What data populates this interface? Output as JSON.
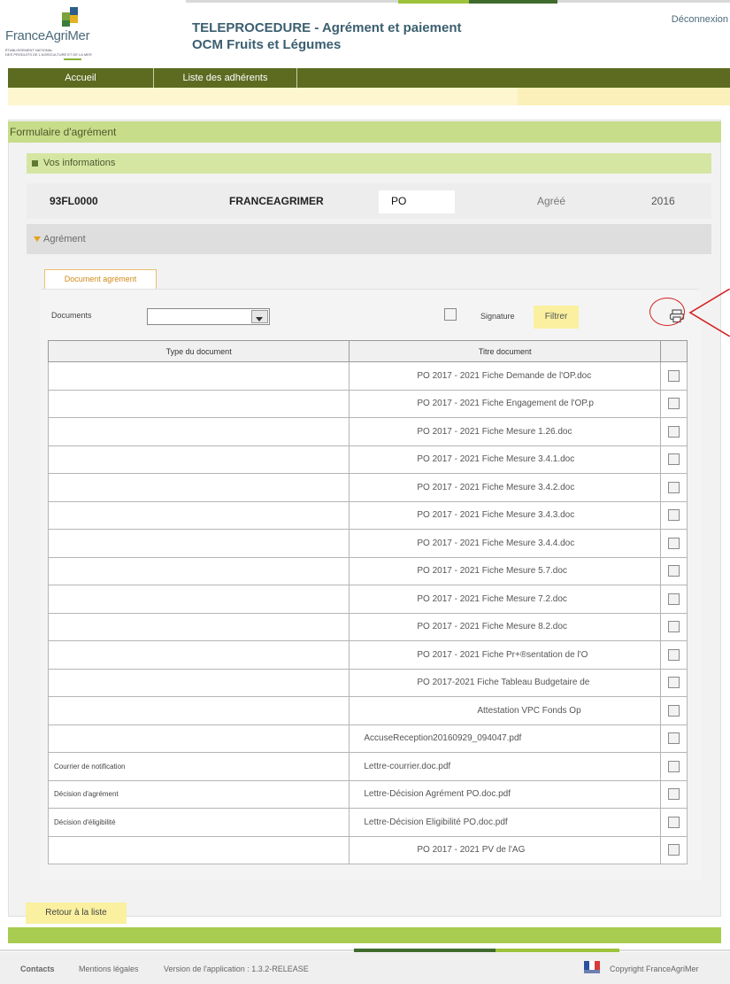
{
  "header": {
    "logo_name": "FranceAgriMer",
    "logo_subtitle": "ÉTABLISSEMENT NATIONAL\nDES PRODUITS DE L'AGRICULTURE ET DE LA MER",
    "title_line1": "TELEPROCEDURE - Agrément et paiement",
    "title_line2": "OCM Fruits et Légumes",
    "logout": "Déconnexion"
  },
  "nav": {
    "items": [
      {
        "label": "Accueil"
      },
      {
        "label": "Liste des adhérents"
      }
    ]
  },
  "form": {
    "title": "Formulaire d'agrément"
  },
  "info": {
    "section_label": "Vos informations",
    "code": "93FL0000",
    "name": "FRANCEAGRIMER",
    "type": "PO",
    "status": "Agréé",
    "year": "2016"
  },
  "agrement": {
    "section_label": "Agrément",
    "tab_label": "Document agrément"
  },
  "filters": {
    "documents_label": "Documents",
    "documents_value": "",
    "signature_label": "Signature",
    "filter_button": "Filtrer"
  },
  "table": {
    "headers": [
      "Type du document",
      "Titre document"
    ],
    "rows": [
      {
        "type": "",
        "title": "PO 2017 - 2021 Fiche Demande de l'OP.doc"
      },
      {
        "type": "",
        "title": "PO 2017 - 2021 Fiche Engagement de l'OP.p"
      },
      {
        "type": "",
        "title": "PO 2017 - 2021 Fiche Mesure 1.26.doc"
      },
      {
        "type": "",
        "title": "PO 2017 - 2021 Fiche Mesure 3.4.1.doc"
      },
      {
        "type": "",
        "title": "PO 2017 - 2021 Fiche Mesure 3.4.2.doc"
      },
      {
        "type": "",
        "title": "PO 2017 - 2021 Fiche Mesure 3.4.3.doc"
      },
      {
        "type": "",
        "title": "PO 2017 - 2021 Fiche Mesure 3.4.4.doc"
      },
      {
        "type": "",
        "title": "PO 2017 - 2021 Fiche Mesure 5.7.doc"
      },
      {
        "type": "",
        "title": "PO 2017 - 2021 Fiche Mesure 7.2.doc"
      },
      {
        "type": "",
        "title": "PO 2017 - 2021 Fiche Mesure 8.2.doc"
      },
      {
        "type": "",
        "title": "PO 2017 - 2021 Fiche Pr+®sentation de l'O"
      },
      {
        "type": "",
        "title": "PO 2017-2021 Fiche Tableau Budgetaire de"
      },
      {
        "type": "",
        "title": "Attestation VPC Fonds Op"
      },
      {
        "type": "",
        "title": "AccuseReception20160929_094047.pdf"
      },
      {
        "type": "Courrier de notification",
        "title": "Lettre-courrier.doc.pdf"
      },
      {
        "type": "Décision d'agrément",
        "title": "Lettre-Décision Agrément PO.doc.pdf"
      },
      {
        "type": "Décision d'éligibilité",
        "title": "Lettre-Décision Eligibilité PO.doc.pdf"
      },
      {
        "type": "",
        "title": "PO 2017 - 2021 PV de l'AG"
      }
    ]
  },
  "buttons": {
    "back": "Retour à la liste"
  },
  "footer": {
    "contacts": "Contacts",
    "legal": "Mentions légales",
    "version": "Version de l'application : 1.3.2-RELEASE",
    "copyright": "Copyright FranceAgriMer"
  },
  "colors": {
    "nav_bg": "#5c6b20",
    "section_green": "#c7dd8a",
    "accent_yellow": "#faf0a0",
    "annotation_red": "#d42020",
    "tab_orange": "#d08a18"
  },
  "icons": [
    "logo-mark",
    "dropdown-arrow-icon",
    "print-icon",
    "annotation-circle",
    "annotation-arrow",
    "french-flag-icon"
  ]
}
